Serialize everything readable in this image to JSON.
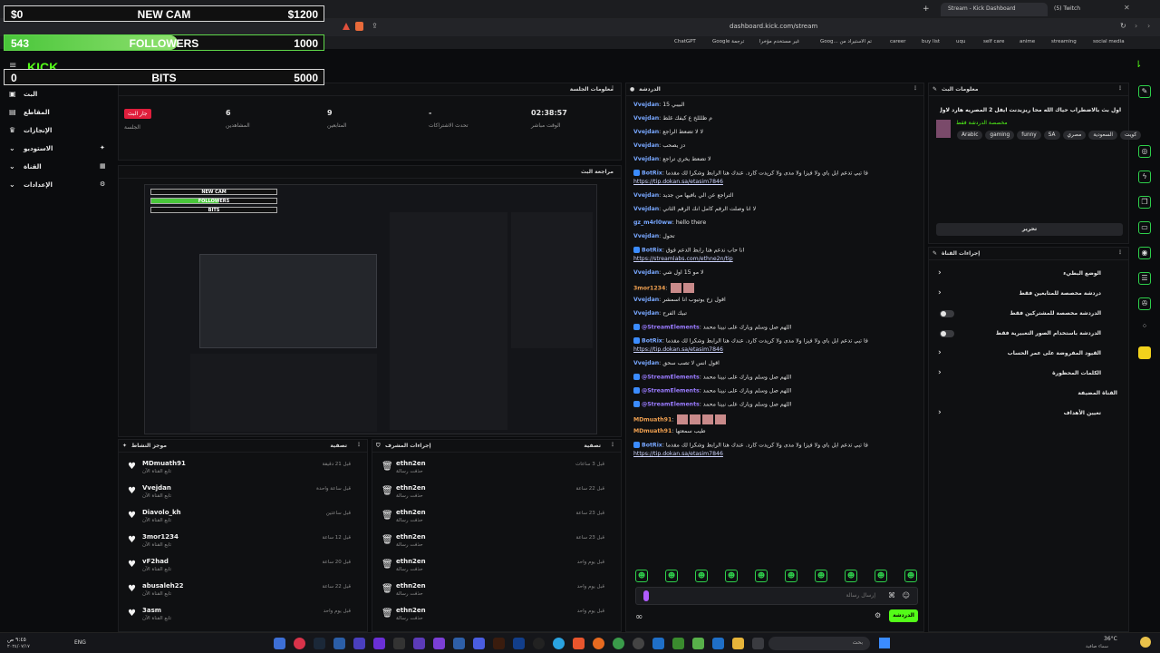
{
  "browser": {
    "tabs": [
      {
        "label": "Stream - Kick Dashboard"
      },
      {
        "label": "(5) Twitch"
      }
    ],
    "url": "dashboard.kick.com/stream",
    "bookmarks": [
      "ChatGPT",
      "Google ترجمة",
      "غير مستخدم مؤخرا",
      "Goog... تم الاستيراد من",
      "career",
      "buy list",
      "uqu",
      "self care",
      "anime",
      "streaming",
      "social media"
    ]
  },
  "overlays": {
    "cam_goal": {
      "left": "$0",
      "title": "NEW CAM",
      "right": "$1200"
    },
    "followers_goal": {
      "left": "543",
      "title": "FOLLOWERS",
      "right": "1000",
      "progress": 0.543
    },
    "bits_goal": {
      "left": "0",
      "title": "BITS",
      "right": "5000"
    }
  },
  "sidebar": {
    "logo": "KICK",
    "items": [
      {
        "label": "البث"
      },
      {
        "label": "المقاطع"
      },
      {
        "label": "الإنجازات"
      },
      {
        "label": "الاستوديو"
      },
      {
        "label": "القناة"
      },
      {
        "label": "الإعدادات"
      }
    ]
  },
  "session": {
    "title": "معلومات الجلسة",
    "stats": [
      {
        "value": "02:38:57",
        "label": "الوقت مباشر"
      },
      {
        "value": "-",
        "label": "تحدث الاشتراكات"
      },
      {
        "value": "9",
        "label": "المتابعين"
      },
      {
        "value": "6",
        "label": "المشاهدين"
      },
      {
        "badge": "جار البث",
        "label": "الجلسة"
      }
    ]
  },
  "preview": {
    "title": "مراجعة البث"
  },
  "activity": {
    "title": "موجز النشاط",
    "filter": "تصفية",
    "rows": [
      {
        "name": "MDmuath91",
        "sub": "تابع القناة الآن",
        "time": "قبل 21 دقيقة"
      },
      {
        "name": "Vvejdan",
        "sub": "تابع القناة الآن",
        "time": "قبل ساعة واحدة"
      },
      {
        "name": "Diavolo_kh",
        "sub": "تابع القناة الآن",
        "time": "قبل ساعتين"
      },
      {
        "name": "3mor1234",
        "sub": "تابع القناة الآن",
        "time": "قبل 12 ساعة"
      },
      {
        "name": "vF2had",
        "sub": "تابع القناة الآن",
        "time": "قبل 20 ساعة"
      },
      {
        "name": "abusaleh22",
        "sub": "تابع القناة الآن",
        "time": "قبل 22 ساعة"
      },
      {
        "name": "3asm",
        "sub": "تابع القناة الآن",
        "time": "قبل يوم واحد"
      }
    ]
  },
  "mod": {
    "title": "إجراءات المشرف",
    "filter": "تصفية",
    "rows": [
      {
        "name": "ethn2en",
        "sub": "حذفت رسالة",
        "time": "قبل 3 ساعات"
      },
      {
        "name": "ethn2en",
        "sub": "حذفت رسالة",
        "time": "قبل 22 ساعة"
      },
      {
        "name": "ethn2en",
        "sub": "حذفت رسالة",
        "time": "قبل 23 ساعة"
      },
      {
        "name": "ethn2en",
        "sub": "حذفت رسالة",
        "time": "قبل 23 ساعة"
      },
      {
        "name": "ethn2en",
        "sub": "حذفت رسالة",
        "time": "قبل يوم واحد"
      },
      {
        "name": "ethn2en",
        "sub": "حذفت رسالة",
        "time": "قبل يوم واحد"
      },
      {
        "name": "ethn2en",
        "sub": "حذفت رسالة",
        "time": "قبل يوم واحد"
      }
    ]
  },
  "chat": {
    "title": "الدردشة",
    "lines": [
      {
        "user": "Vvejdan",
        "text": "البيبي 15"
      },
      {
        "user": "Vvejdan",
        "text": "م ظلللخ ع كيفك غلط"
      },
      {
        "user": "Vvejdan",
        "text": "لا لا تضعط الراجع"
      },
      {
        "user": "Vvejdan",
        "text": "دز يصحب"
      },
      {
        "user": "Vvejdan",
        "text": "لا تضعط يخري تراجع"
      },
      {
        "user": "BotRix",
        "text": "فا تبي تدعم ابل باي ولا فيزا ولا مدى ولا كريدت كارد. عندك هنا الرابط وشكرا لك مقدما",
        "link": "https://tip.dokan.sa/etasim7846"
      },
      {
        "user": "Vvejdan",
        "text": "التراجع عن الي بافيها من جديد"
      },
      {
        "user": "Vvejdan",
        "text": "لا انا وصلت الرقم كامل انك الرقم الثاني"
      },
      {
        "user": "gz_m4rl0ww",
        "text": "hello there"
      },
      {
        "user": "Vvejdan",
        "text": "تحول"
      },
      {
        "user": "BotRix",
        "text": "انا حاب ندعم هنا رابط الدعم فوق",
        "link": "https://streamlabs.com/ethne2n/tip"
      },
      {
        "user": "Vvejdan",
        "text": "لا مو 15 اول شي"
      },
      {
        "user": "3mor1234",
        "text": ""
      },
      {
        "user": "Vvejdan",
        "text": "اقول زخ يوتيوب انا اسمشر"
      },
      {
        "user": "Vvejdan",
        "text": "تبيك الفرح"
      },
      {
        "user": "@StreamElements",
        "text": "اللهم صل وسلم وبارك على نبينا محمد"
      },
      {
        "user": "BotRix",
        "text": "فا تبي تدعم ابل باي ولا فيزا ولا مدى ولا كريدت كارد. عندك هنا الرابط وشكرا لك مقدما",
        "link": "https://tip.dokan.sa/etasim7846"
      },
      {
        "user": "Vvejdan",
        "text": "اقول انس لا تصب سحق"
      },
      {
        "user": "@StreamElements",
        "text": "اللهم صل وسلم وبارك على نبينا محمد"
      },
      {
        "user": "@StreamElements",
        "text": "اللهم صل وسلم وبارك على نبينا محمد"
      },
      {
        "user": "@StreamElements",
        "text": "اللهم صل وسلم وبارك على نبينا محمد"
      },
      {
        "user": "MDmuath91",
        "text": ""
      },
      {
        "user": "MDmuath91",
        "text": "طيب سمعتها"
      },
      {
        "user": "BotRix",
        "text": "فا تبي تدعم ابل باي ولا فيزا ولا مدى ولا كريدت كارد. عندك هنا الرابط وشكرا لك مقدما",
        "link": "https://tip.dokan.sa/etasim7846"
      }
    ],
    "input_placeholder": "إرسال رسالة",
    "send_label": "الدردشة"
  },
  "stream_info": {
    "title": "معلومات البث",
    "stream_title": "اول بث بالاضطراب حياك الله محا ريزيدنت ايفل 2 المصريه هارد لاول مرة",
    "category": "مخصصة الدردشة فقط",
    "tags": [
      "Arabic",
      "gaming",
      "funny",
      "SA",
      "مصري",
      "السعودية",
      "كويت"
    ],
    "edit_label": "تحرير"
  },
  "channel_actions": {
    "title": "إجراءات القناة",
    "items": [
      {
        "label": "الوضع البطيء",
        "kind": "arrow"
      },
      {
        "label": "دردشة مخصصة للمتابعين فقط",
        "kind": "arrow"
      },
      {
        "label": "الدردشة مخصصة للمشتركين فقط",
        "kind": "toggle"
      },
      {
        "label": "الدردشة باستخدام الصور التعبيرية فقط",
        "kind": "toggle"
      },
      {
        "label": "القيود المفروضة على عمر الحساب",
        "kind": "arrow"
      },
      {
        "label": "الكلمات المحظورة",
        "kind": "arrow"
      },
      {
        "label": "القناة المضيفة",
        "kind": "none"
      },
      {
        "label": "تعيين الأهداف",
        "kind": "arrow"
      }
    ]
  },
  "taskbar": {
    "search": "بحث",
    "lang": "ENG",
    "time": "٩:٤٥ ص",
    "date": "٢٠٢٤/٠٧/١٧",
    "weather_temp": "36°C",
    "weather_desc": "سماء صافية"
  }
}
